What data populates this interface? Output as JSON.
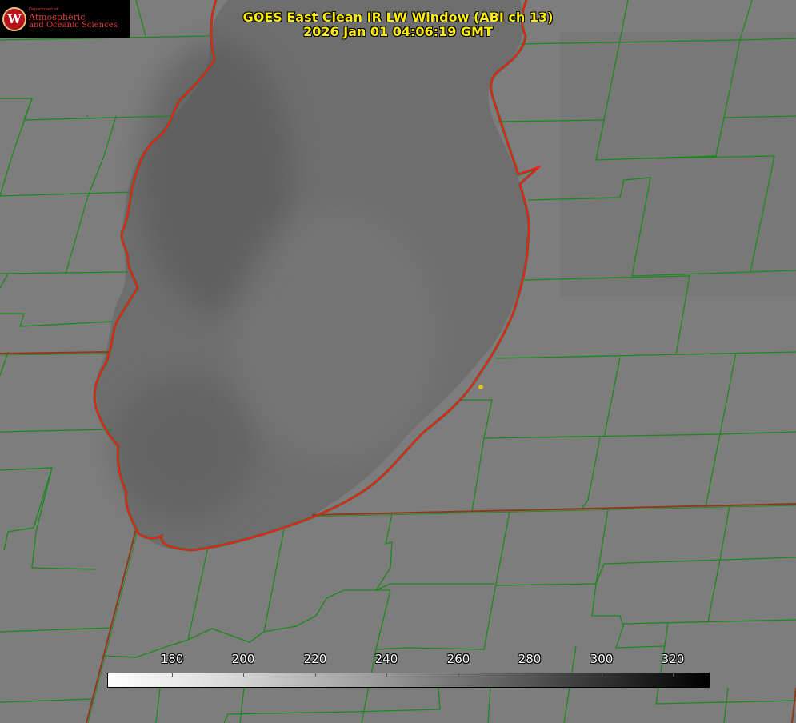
{
  "title": {
    "line1": "GOES East Clean IR LW Window (ABI ch 13)",
    "line2": "2026 Jan 01 04:06:19 GMT"
  },
  "logo": {
    "dept": "Department of",
    "line1": "Atmospheric",
    "line2": "and Oceanic Sciences",
    "seal_letter": "W"
  },
  "colorbar": {
    "ticks": [
      "180",
      "200",
      "220",
      "240",
      "260",
      "280",
      "300",
      "320"
    ],
    "min_value": 162,
    "max_value": 330,
    "gradient": "white-to-black"
  },
  "map": {
    "icons": [
      "county-boundary-lines",
      "state-boundary-lines",
      "lake-shoreline",
      "city-marker"
    ],
    "colors": {
      "county_lines": "#1a8a1a",
      "state_lines": "#8b3a1a",
      "shoreline": "#ff1a1a",
      "marker": "#e0c020",
      "land": "#7d7d7d",
      "lake": "#6e6e6e"
    }
  }
}
